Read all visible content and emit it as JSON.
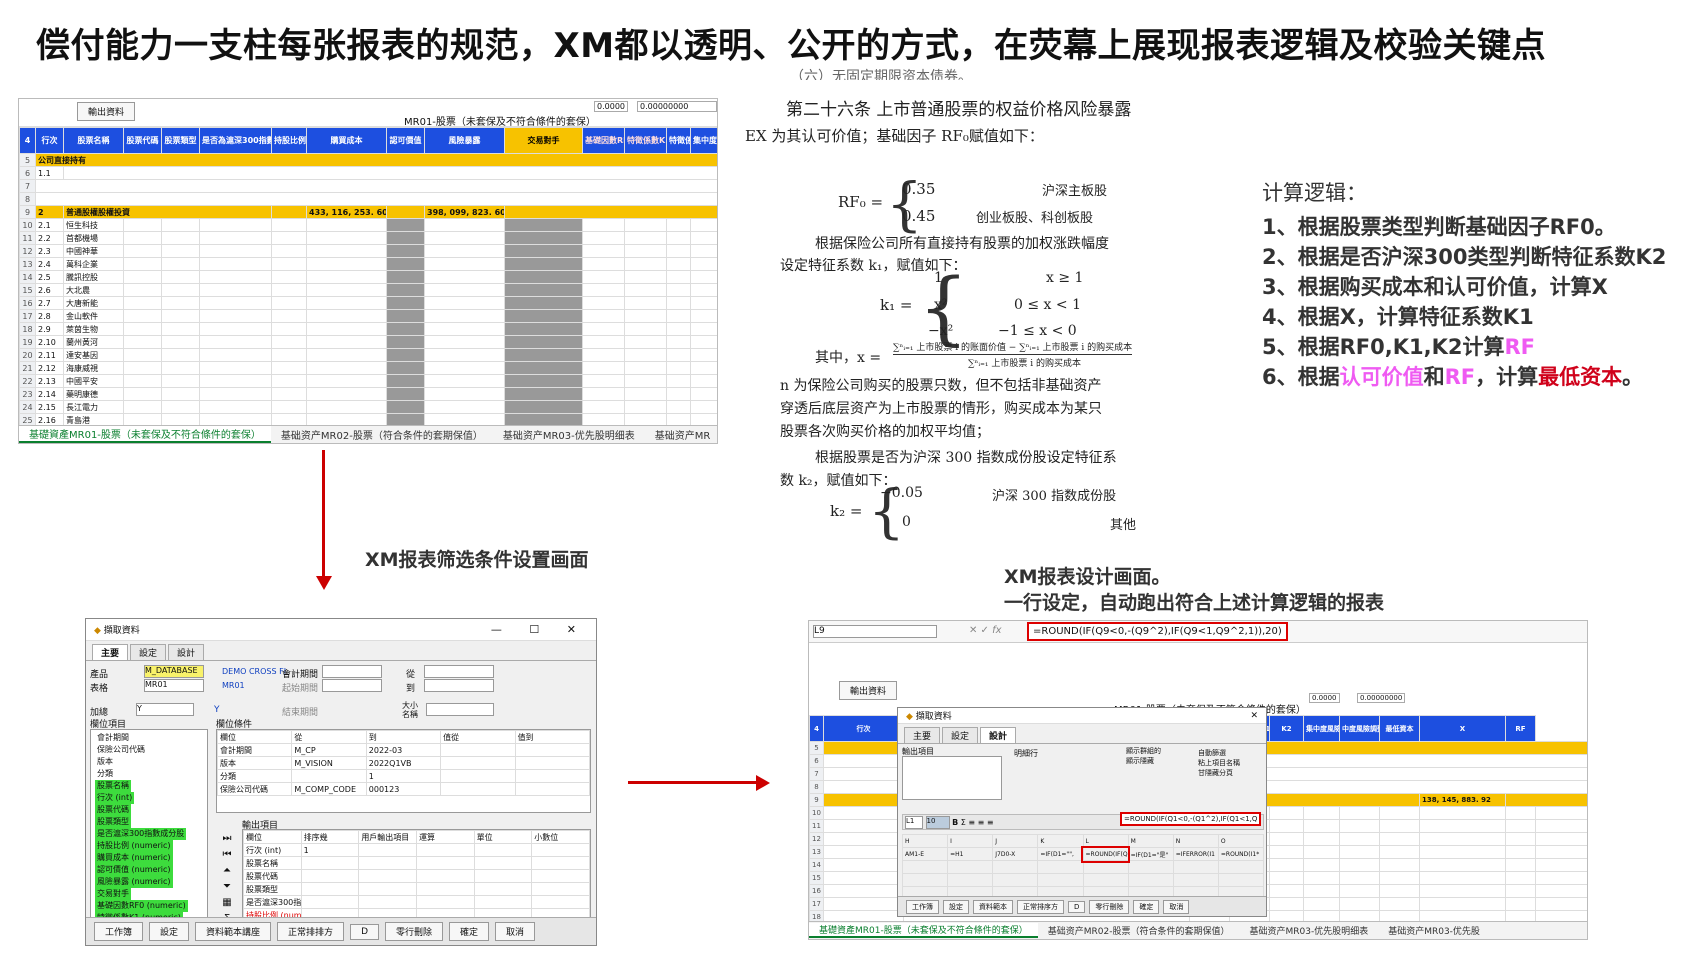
{
  "title": "偿付能力一支柱每张报表的规范，XM都以透明、公开的方式，在荧幕上展现报表逻辑及校验关键点",
  "sheet1": {
    "export_button": "輸出資料",
    "cell_a": "0.0000",
    "cell_b": "0.00000000",
    "report_title": "MR01-股票（未套保及不符合條件的套保）",
    "headers": [
      "行次",
      "股票名稱",
      "股票代碼",
      "股票類型",
      "是否為滬深300指數成分股",
      "持股比例",
      "購買成本",
      "認可價值",
      "風險暴露",
      "交易對手",
      "基礎因數RF0",
      "特徵係數K1",
      "特徵係數K2",
      "集中度"
    ],
    "row_section1": "公司直接持有",
    "row_section2": "普通股權股權投資",
    "sum_cost": "433, 116, 253. 60",
    "sum_exposure": "398, 099, 823. 60",
    "row_numbers": [
      "1",
      "2",
      "3",
      "4",
      "5",
      "6",
      "7",
      "8",
      "9",
      "10",
      "11",
      "12",
      "13",
      "14",
      "15",
      "16",
      "17",
      "18",
      "19",
      "20",
      "21",
      "22",
      "23",
      "24"
    ],
    "stock_names": [
      "恒生科技",
      "首都機場",
      "中國神華",
      "萬科企業",
      "騰訊控股",
      "大北農",
      "大唐新能",
      "金山軟件",
      "萊茵生物",
      "蘭州黃河",
      "達安基因",
      "海康威視",
      "中國平安",
      "藥明康德",
      "長江電力",
      "青島港"
    ],
    "tabs": [
      "基礎資產MR01-股票（未套保及不符合條件的套保）",
      "基础资产MR02-股票（符合条件的套期保值）",
      "基础资产MR03-优先股明细表",
      "基础资产MR"
    ]
  },
  "caption_filter": "XM报表筛选条件设置画面",
  "caption_design_1": "XM报表设计画面。",
  "caption_design_2": "一行设定，自动跑出符合上述计算逻辑的报表",
  "regulation": {
    "line0": "（六）无固定期限资本债券。",
    "article": "第二十六条  上市普通股票的权益价格风险暴露",
    "line1": "EX 为其认可价值；基础因子 RF₀赋值如下：",
    "rf0_lhs": "RF₀ =",
    "rf0_v1": "0.35",
    "rf0_c1": "沪深主板股",
    "rf0_v2": "0.45",
    "rf0_c2": "创业板股、科创板股",
    "p2a": "根据保险公司所有直接持有股票的加权涨跌幅度",
    "p2b": "设定特征系数 k₁，赋值如下：",
    "k1_lhs": "k₁ =",
    "k1_v1": "1",
    "k1_c1": "x ≥ 1",
    "k1_v2": "x²",
    "k1_c2": "0 ≤ x < 1",
    "k1_v3": "−x²",
    "k1_c3": "−1 ≤ x < 0",
    "x_prefix": "其中，x =",
    "x_num": "∑ⁿᵢ₌₁ 上市股票 i 的账面价值 − ∑ⁿᵢ₌₁ 上市股票 i 的购买成本",
    "x_den": "∑ⁿᵢ₌₁ 上市股票 i 的购买成本",
    "p3a": "n 为保险公司购买的股票只数，但不包括非基础资产",
    "p3b": "穿透后底层资产为上市股票的情形，购买成本为某只",
    "p3c": "股票各次购买价格的加权平均值；",
    "p4a": "根据股票是否为沪深 300 指数成份股设定特征系",
    "p4b": "数 k₂，赋值如下：",
    "k2_lhs": "k₂ =",
    "k2_v1": "−0.05",
    "k2_c1": "沪深 300 指数成份股",
    "k2_v2": "0",
    "k2_c2": "其他"
  },
  "logic": {
    "title": "计算逻辑：",
    "l1": "1、根据股票类型判断基础因子RF0。",
    "l2": "2、根据是否沪深300类型判断特征系数K2",
    "l3": "3、根据购买成本和认可价值，计算X",
    "l4": "4、根据X，计算特征系数K1",
    "l5a": "5、根据RF0,K1,K2计算",
    "l5b": "RF",
    "l6a": "6、根据",
    "l6b": "认可价值",
    "l6c": "和",
    "l6d": "RF",
    "l6e": "，计算",
    "l6f": "最低资本",
    "l6g": "。",
    "colors": {
      "pink": "#ef5bf2",
      "red": "#d0021b"
    }
  },
  "dialog1": {
    "title": "擷取資料",
    "tabs": [
      "主要",
      "設定",
      "設計"
    ],
    "product_label": "產品",
    "product_value": "M_DATABASE",
    "product_desc": "DEMO CROSS FI",
    "table_label": "表格",
    "table_value": "MR01",
    "table_desc": "MR01",
    "accounting_period": "會計期間",
    "start_period": "起始期間",
    "from_label": "從",
    "to_label": "到",
    "sort_label": "加總",
    "sort_value": "Y",
    "y_label": "Y",
    "end_period": "結束期間",
    "size_label": "大小",
    "name_label": "名稱",
    "field_list_title": "欄位項目",
    "field_items": [
      "會計期間",
      "保險公司代碼",
      "版本",
      "分類"
    ],
    "field_items_green": [
      "股票名稱",
      "行次 (int)",
      "股票代碼",
      "股票類型",
      "是否滬深300指數成分股",
      "持股比例 (numeric)",
      "購買成本 (numeric)",
      "認可價值 (numeric)",
      "風險暴露 (numeric)",
      "交易對手",
      "基礎因數RF0 (numeric)",
      "特徵係數K1 (numeric)",
      "特徵係數K2 (numeric)"
    ],
    "cond_title": "欄位條件",
    "cond_headers": [
      "欄位",
      "從",
      "到",
      "值從",
      "值到"
    ],
    "cond_rows": [
      [
        "會計期間",
        "M_CP",
        "2022-03"
      ],
      [
        "版本",
        "M_VISION",
        "2022Q1VB"
      ],
      [
        "分類",
        "",
        "1"
      ],
      [
        "保險公司代碼",
        "M_COMP_CODE",
        "000123"
      ]
    ],
    "out_title": "輸出項目",
    "out_headers": [
      "欄位",
      "排序幾",
      "用戶輸出項目",
      "運算",
      "單位",
      "小數位"
    ],
    "out_rows": [
      "行次 (int)",
      "股票名稱",
      "股票代碼",
      "股票類型",
      "是否滬深300指數成份股"
    ],
    "out_row_sort": "1",
    "out_red": [
      "持股比例 (numeric)",
      "購買成本 (numeric)"
    ],
    "buttons": [
      "工作簿",
      "設定",
      "資料範本講座",
      "正常排排方",
      "D",
      "零行刪除",
      "確定",
      "取消"
    ]
  },
  "sheet2": {
    "cell_ref": "L9",
    "formula": "=ROUND(IF(Q9<0,-(Q9^2),IF(Q9<1,Q9^2,1)),20)",
    "export_button": "輸出資料",
    "report_title": "MR01-股票（未套保及不符合條件的套保）",
    "cell_a": "0.0000",
    "cell_b": "0.00000000",
    "headers": [
      "行次",
      "基礎因數RF0",
      "特徵係數K1",
      "K2",
      "集中度風險調整",
      "中度風險調整",
      "最低資本",
      "X",
      "RF"
    ],
    "sum_value": "138, 145, 883. 92",
    "tabs": [
      "基礎資產MR01-股票（未套保及不符合條件的套保）",
      "基础资产MR02-股票（符合条件的套期保值）",
      "基础资产MR03-优先股明细表",
      "基础资产MR03-优先股"
    ]
  },
  "dialog2": {
    "title": "擷取資料",
    "tabs": [
      "主要",
      "設定",
      "設計"
    ],
    "out_title": "輸出項目",
    "desc_label": "明細行",
    "opt1": "顯示群組的",
    "opt2": "自動篩選",
    "opt3": "粘上項目名稱",
    "opt4": "顯示隱藏",
    "opt5": "甘隱藏分頁",
    "cell_name": "L1",
    "font_size": "10",
    "formula_box": "=ROUND(IF(Q1<0,-(Q1^2),IF(Q1<1,Q",
    "grid_headers": [
      "H",
      "I",
      "J",
      "K",
      "L",
      "M",
      "N",
      "O"
    ],
    "grid_row": [
      "AM1-E",
      "=H1",
      "J7D0-X",
      "=IF(D1=\"\",",
      "=ROUND(IF(Q1",
      "=IF(D1=\"是\"",
      "=IFERROR(I1",
      "=ROUND(I1*"
    ],
    "buttons": [
      "工作簿",
      "設定",
      "資料範本",
      "正常排序方",
      "D",
      "零行刪除",
      "確定",
      "取消"
    ]
  }
}
